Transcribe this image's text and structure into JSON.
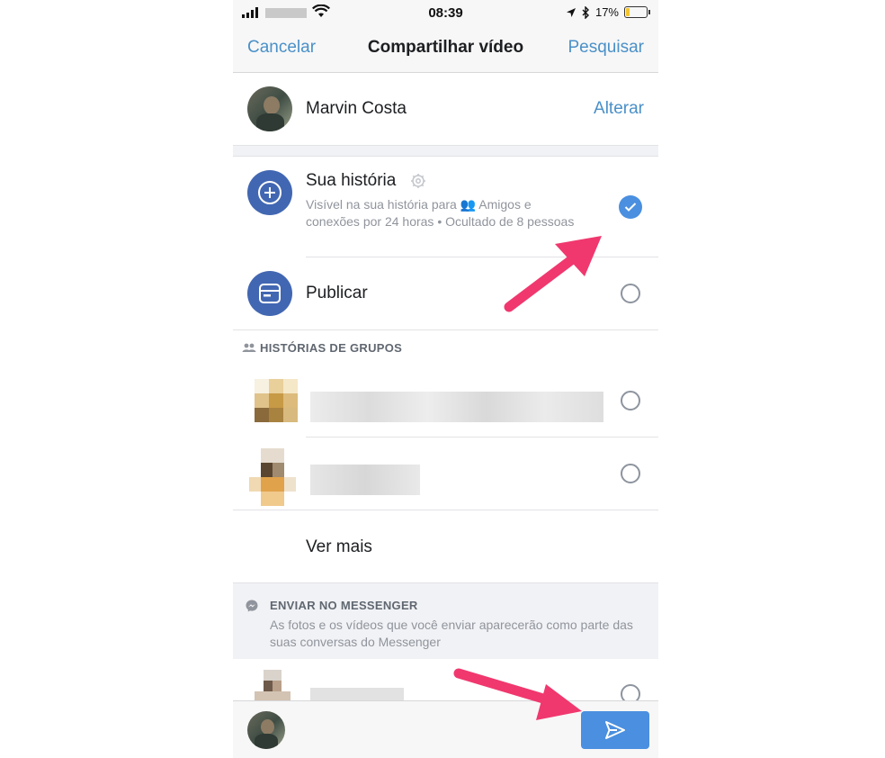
{
  "status_bar": {
    "time": "08:39",
    "battery": "17%"
  },
  "nav": {
    "cancel": "Cancelar",
    "title": "Compartilhar vídeo",
    "search": "Pesquisar"
  },
  "profile": {
    "name": "Marvin Costa",
    "change": "Alterar"
  },
  "story": {
    "title": "Sua história",
    "description": "Visível na sua história para 👥 Amigos e conexões por 24 horas • Ocultado de 8 pessoas",
    "selected": true
  },
  "publish": {
    "title": "Publicar",
    "selected": false
  },
  "group_stories": {
    "header": "HISTÓRIAS DE GRUPOS",
    "see_more": "Ver mais"
  },
  "messenger": {
    "header": "ENVIAR NO MESSENGER",
    "description": "As fotos e os vídeos que você enviar aparecerão como parte das suas conversas do Messenger"
  },
  "colors": {
    "accent": "#4a90c8",
    "brand": "#4267b2",
    "check": "#4a8fe0",
    "arrow": "#f0386e"
  },
  "icons": [
    "plus-circle-icon",
    "publish-icon",
    "gear-icon",
    "check-icon",
    "group-icon",
    "messenger-icon",
    "send-icon"
  ]
}
